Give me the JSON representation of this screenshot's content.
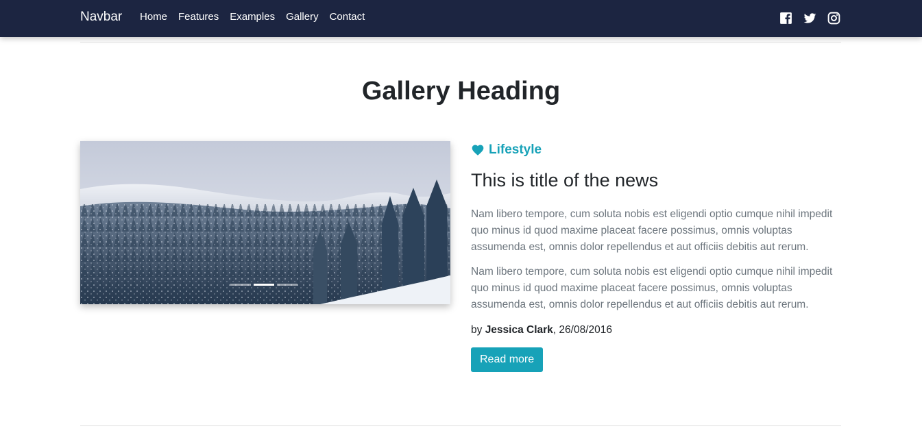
{
  "navbar": {
    "brand": "Navbar",
    "links": [
      "Home",
      "Features",
      "Examples",
      "Gallery",
      "Contact"
    ],
    "social_icons": [
      "facebook-icon",
      "twitter-icon",
      "instagram-icon"
    ]
  },
  "page": {
    "heading": "Gallery Heading"
  },
  "carousel": {
    "slide_count": 3,
    "active_index": 1
  },
  "article": {
    "category_icon": "heart-icon",
    "category": "Lifestyle",
    "title": "This is title of the news",
    "paragraphs": [
      "Nam libero tempore, cum soluta nobis est eligendi optio cumque nihil impedit quo minus id quod maxime placeat facere possimus, omnis voluptas assumenda est, omnis dolor repellendus et aut officiis debitis aut rerum.",
      "Nam libero tempore, cum soluta nobis est eligendi optio cumque nihil impedit quo minus id quod maxime placeat facere possimus, omnis voluptas assumenda est, omnis dolor repellendus et aut officiis debitis aut rerum."
    ],
    "by_prefix": "by",
    "author": "Jessica Clark",
    "date": ", 26/08/2016",
    "button_label": "Read more"
  },
  "colors": {
    "navbar_bg": "#1c2541",
    "accent": "#17a2b8",
    "muted_text": "#6c757d"
  }
}
